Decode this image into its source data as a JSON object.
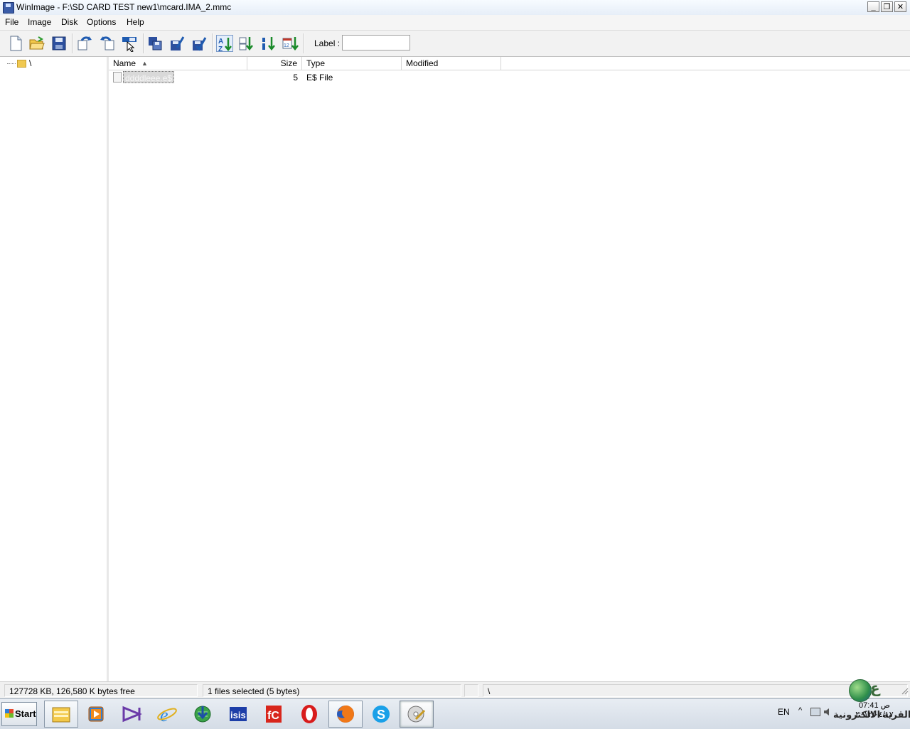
{
  "window": {
    "title": "WinImage - F:\\SD CARD TEST new1\\mcard.IMA_2.mmc",
    "minimize": "_",
    "restore": "❐",
    "close": "✕"
  },
  "menu": [
    "File",
    "Image",
    "Disk",
    "Options",
    "Help"
  ],
  "toolbar": {
    "label_text": "Label :",
    "label_value": "",
    "buttons": [
      "new-icon",
      "open-icon",
      "save-icon",
      "inject-icon",
      "extract-icon",
      "select-icon",
      "disk-copy-icon",
      "disk-format-icon",
      "disk-check-icon",
      "sort-name-icon",
      "sort-type-icon",
      "sort-size-icon",
      "sort-date-icon"
    ]
  },
  "tree": {
    "root": "\\"
  },
  "list": {
    "columns": {
      "name": "Name",
      "size": "Size",
      "type": "Type",
      "modified": "Modified"
    },
    "sort_indicator": "▲",
    "rows": [
      {
        "name": "ddddleee.e$",
        "size": "5",
        "type": "E$ File",
        "modified": ""
      }
    ]
  },
  "status": {
    "free": "127728 KB, 126,580 K bytes free",
    "selected": "1 files selected (5 bytes)",
    "blank": "",
    "path": "\\"
  },
  "taskbar": {
    "start": "Start",
    "apps": [
      "explorer",
      "media-player",
      "visual-studio",
      "internet-explorer",
      "idm",
      "isis",
      "fc",
      "opera",
      "firefox",
      "skype",
      "winimage"
    ],
    "isis_text": "isis",
    "fc_text": "fC",
    "lang": "EN",
    "clock_time": "07:41 ص",
    "clock_date": "٢٠١٢/٠٤/١٧",
    "watermark": "القرية الالكترونية"
  },
  "colors": {
    "selection": "#d9d9d9",
    "title_bg": "#e6eef8",
    "taskbar_bg": "#d4dce6"
  }
}
